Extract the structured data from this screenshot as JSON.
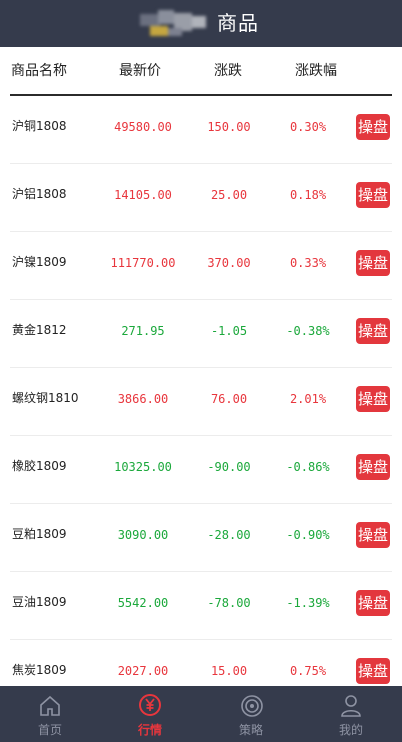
{
  "header": {
    "title": "商品"
  },
  "columns": {
    "name": "商品名称",
    "price": "最新价",
    "change": "涨跌",
    "change_pct": "涨跌幅"
  },
  "trade_label": "操盘",
  "rows": [
    {
      "name": "沪铜1808",
      "price": "49580.00",
      "change": "150.00",
      "pct": "0.30%",
      "trend": "up"
    },
    {
      "name": "沪铝1808",
      "price": "14105.00",
      "change": "25.00",
      "pct": "0.18%",
      "trend": "up"
    },
    {
      "name": "沪镍1809",
      "price": "111770.00",
      "change": "370.00",
      "pct": "0.33%",
      "trend": "up"
    },
    {
      "name": "黄金1812",
      "price": "271.95",
      "change": "-1.05",
      "pct": "-0.38%",
      "trend": "down"
    },
    {
      "name": "螺纹钢1810",
      "price": "3866.00",
      "change": "76.00",
      "pct": "2.01%",
      "trend": "up"
    },
    {
      "name": "橡胶1809",
      "price": "10325.00",
      "change": "-90.00",
      "pct": "-0.86%",
      "trend": "down"
    },
    {
      "name": "豆粕1809",
      "price": "3090.00",
      "change": "-28.00",
      "pct": "-0.90%",
      "trend": "down"
    },
    {
      "name": "豆油1809",
      "price": "5542.00",
      "change": "-78.00",
      "pct": "-1.39%",
      "trend": "down"
    },
    {
      "name": "焦炭1809",
      "price": "2027.00",
      "change": "15.00",
      "pct": "0.75%",
      "trend": "up"
    }
  ],
  "colors": {
    "header_bg": "#353b4c",
    "up": "#e8363d",
    "down": "#1ba83b",
    "trade_button": "#e3373d",
    "tab_active": "#e8363d",
    "tab_inactive": "#8e93a3"
  },
  "tabbar": {
    "items": [
      {
        "label": "首页",
        "icon": "home-icon",
        "active": false
      },
      {
        "label": "行情",
        "icon": "yen-coin-icon",
        "active": true
      },
      {
        "label": "策略",
        "icon": "target-icon",
        "active": false
      },
      {
        "label": "我的",
        "icon": "user-icon",
        "active": false
      }
    ]
  }
}
